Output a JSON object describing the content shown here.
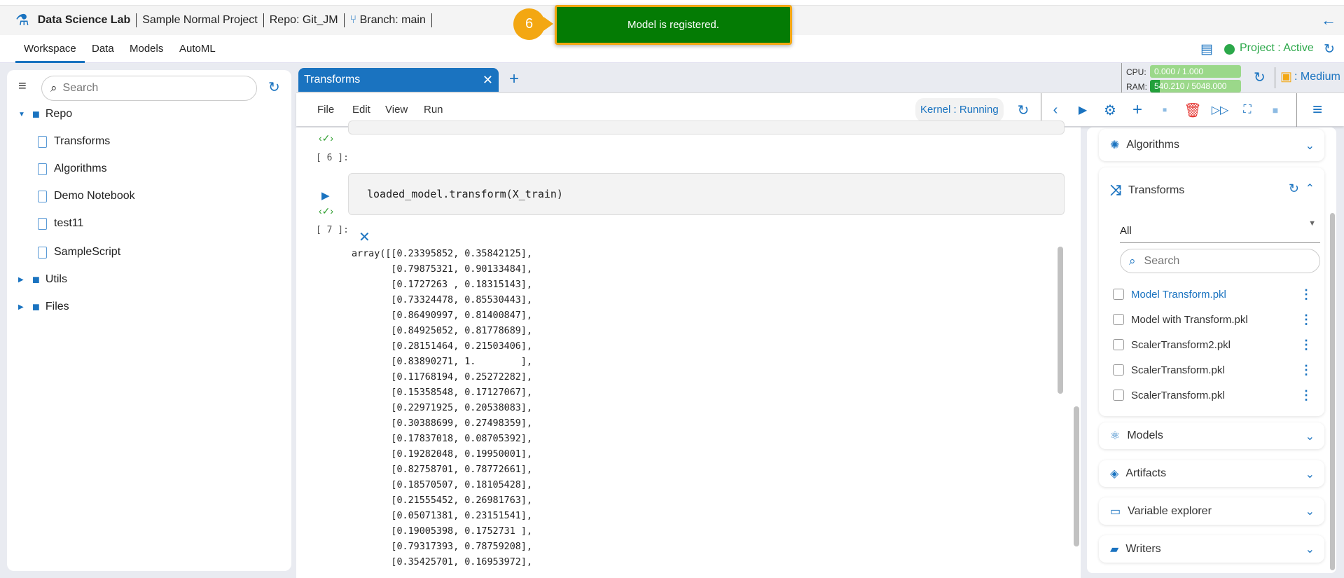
{
  "header": {
    "app": "Data Science Lab",
    "project": "Sample Normal Project",
    "repo": "Repo: Git_JM",
    "branch": "Branch: main"
  },
  "toast": {
    "step": "6",
    "message": "Model is registered."
  },
  "nav": {
    "tabs": [
      "Workspace",
      "Data",
      "Models",
      "AutoML"
    ],
    "project_status": "Project : Active"
  },
  "sidebar": {
    "search_placeholder": "Search",
    "tree": [
      {
        "label": "Repo",
        "type": "folder",
        "open": true
      },
      {
        "label": "Transforms",
        "type": "file"
      },
      {
        "label": "Algorithms",
        "type": "file"
      },
      {
        "label": "Demo Notebook",
        "type": "file"
      },
      {
        "label": "test11",
        "type": "file"
      },
      {
        "label": "SampleScript",
        "type": "file"
      },
      {
        "label": "Utils",
        "type": "folder",
        "open": false
      },
      {
        "label": "Files",
        "type": "folder",
        "open": false
      }
    ]
  },
  "notebook": {
    "tab": "Transforms",
    "menu": [
      "File",
      "Edit",
      "View",
      "Run"
    ],
    "kernel": "Kernel : Running",
    "resources": {
      "cpu_label": "CPU:",
      "cpu_value": "0.000 / 1.000",
      "cpu_fraction": 0.0,
      "ram_label": "RAM:",
      "ram_value": "540.210 / 5048.000",
      "ram_fraction": 0.107,
      "size": ": Medium"
    },
    "cell6_prompt": "[ 6 ]:",
    "cell7_prompt": "[ 7 ]:",
    "cell7_code": "loaded_model.transform(X_train)",
    "output": [
      "array([[0.23395852, 0.35842125],",
      "       [0.79875321, 0.90133484],",
      "       [0.1727263 , 0.18315143],",
      "       [0.73324478, 0.85530443],",
      "       [0.86490997, 0.81400847],",
      "       [0.84925052, 0.81778689],",
      "       [0.28151464, 0.21503406],",
      "       [0.83890271, 1.        ],",
      "       [0.11768194, 0.25272282],",
      "       [0.15358548, 0.17127067],",
      "       [0.22971925, 0.20538083],",
      "       [0.30388699, 0.27498359],",
      "       [0.17837018, 0.08705392],",
      "       [0.19282048, 0.19950001],",
      "       [0.82758701, 0.78772661],",
      "       [0.18570507, 0.18105428],",
      "       [0.21555452, 0.26981763],",
      "       [0.05071381, 0.23151541],",
      "       [0.19005398, 0.1752731 ],",
      "       [0.79317393, 0.78759208],",
      "       [0.35425701, 0.16953972],"
    ]
  },
  "rightpanel": {
    "algorithms": "Algorithms",
    "transforms": "Transforms",
    "filter": "All",
    "search_placeholder": "Search",
    "items": [
      "Model Transform.pkl",
      "Model with Transform.pkl",
      "ScalerTransform2.pkl",
      "ScalerTransform.pkl",
      "ScalerTransform.pkl"
    ],
    "models": "Models",
    "artifacts": "Artifacts",
    "variable_explorer": "Variable explorer",
    "writers": "Writers"
  },
  "colors": {
    "accent": "#1a73c0",
    "toast": "#047b04",
    "badge": "#f3a712",
    "active": "#2ca84a"
  }
}
